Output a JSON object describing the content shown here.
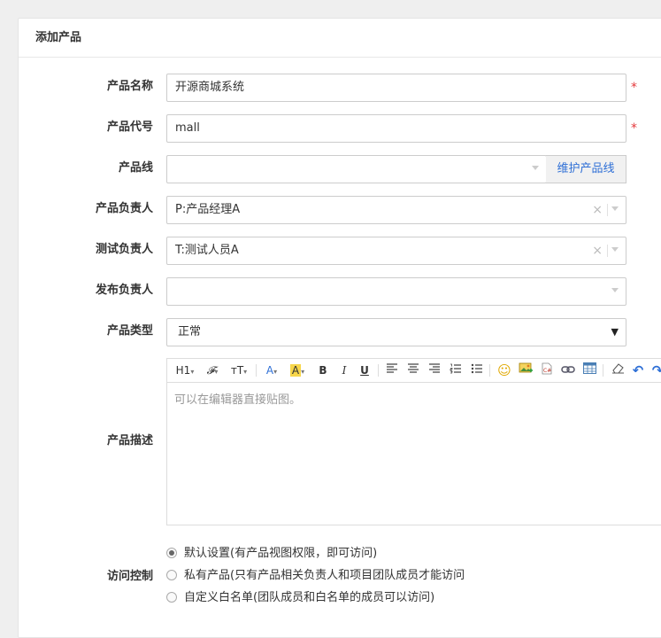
{
  "panel": {
    "title": "添加产品"
  },
  "form": {
    "name": {
      "label": "产品名称",
      "value": "开源商城系统",
      "required": "*"
    },
    "code": {
      "label": "产品代号",
      "value": "mall",
      "required": "*"
    },
    "line": {
      "label": "产品线",
      "value": "",
      "addon": "维护产品线"
    },
    "po": {
      "label": "产品负责人",
      "value": "P:产品经理A",
      "clear": "×"
    },
    "qd": {
      "label": "测试负责人",
      "value": "T:测试人员A",
      "clear": "×"
    },
    "rd": {
      "label": "发布负责人",
      "value": ""
    },
    "type": {
      "label": "产品类型",
      "value": "正常",
      "arrow": "▼"
    },
    "desc": {
      "label": "产品描述",
      "placeholder": "可以在编辑器直接贴图。",
      "toolbar": {
        "heading": "H1",
        "font": "𝓕",
        "size": "тT",
        "forecolor": "A",
        "backcolor": "A",
        "bold": "B",
        "italic": "I",
        "underline": "U",
        "emoticon": "☺",
        "undo": "↶",
        "redo": "↷"
      }
    },
    "acl": {
      "label": "访问控制",
      "options": [
        {
          "label": "默认设置(有产品视图权限，即可访问)",
          "checked": true
        },
        {
          "label": "私有产品(只有产品相关负责人和项目团队成员才能访问",
          "checked": false
        },
        {
          "label": "自定义白名单(团队成员和白名单的成员可以访问)",
          "checked": false
        }
      ]
    }
  },
  "colors": {
    "required": "#e4393c",
    "link": "#2e6fd6"
  }
}
